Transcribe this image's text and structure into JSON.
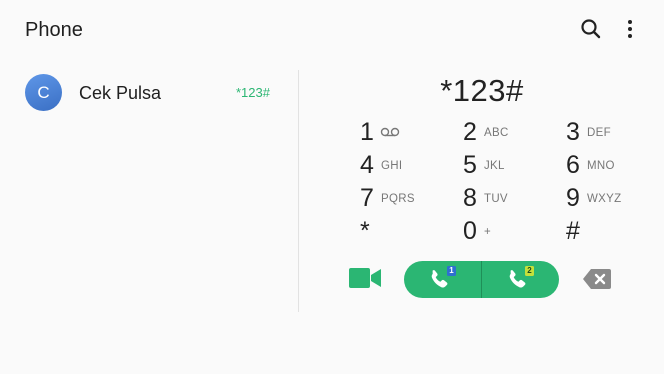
{
  "header": {
    "title": "Phone",
    "search_icon": "search-icon",
    "more_icon": "more-vert-icon"
  },
  "contact": {
    "avatar_letter": "C",
    "name": "Cek Pulsa",
    "number": "*123#"
  },
  "dialer": {
    "display": "*123#",
    "keys": [
      {
        "digit": "1",
        "letters": "",
        "icon": "voicemail-icon"
      },
      {
        "digit": "2",
        "letters": "ABC"
      },
      {
        "digit": "3",
        "letters": "DEF"
      },
      {
        "digit": "4",
        "letters": "GHI"
      },
      {
        "digit": "5",
        "letters": "JKL"
      },
      {
        "digit": "6",
        "letters": "MNO"
      },
      {
        "digit": "7",
        "letters": "PQRS"
      },
      {
        "digit": "8",
        "letters": "TUV"
      },
      {
        "digit": "9",
        "letters": "WXYZ"
      },
      {
        "digit": "*",
        "letters": ""
      },
      {
        "digit": "0",
        "letters": "+"
      },
      {
        "digit": "#",
        "letters": ""
      }
    ]
  },
  "actions": {
    "video_call_icon": "video-camera-icon",
    "sim1_badge": "1",
    "sim2_badge": "2",
    "backspace_icon": "backspace-icon"
  },
  "colors": {
    "accent_green": "#2bb673",
    "avatar_blue": "#4a80d6",
    "sim1_badge": "#2f6fd0",
    "sim2_badge": "#c6e03a"
  }
}
